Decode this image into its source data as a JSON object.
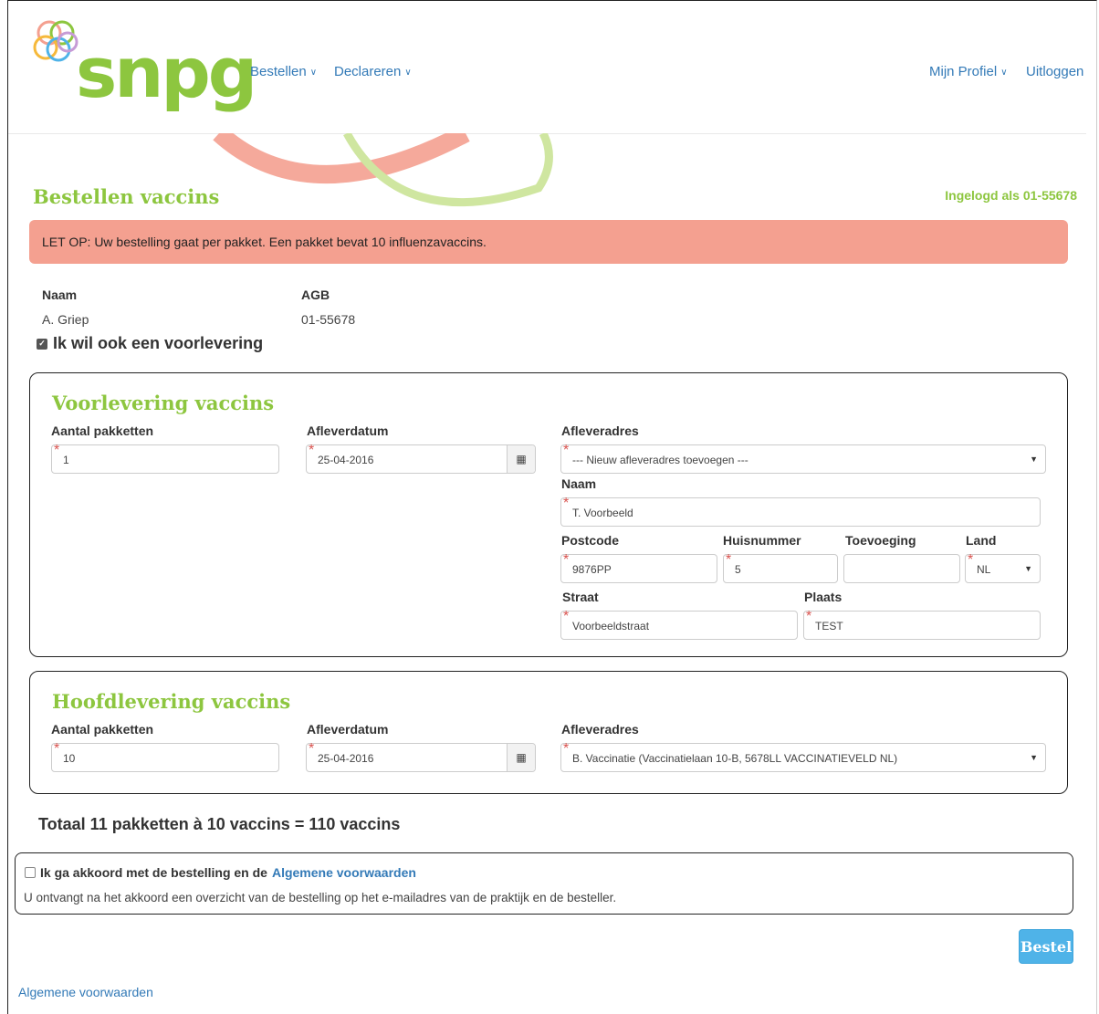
{
  "brand": {
    "logo_text": "snpg",
    "accent": "#8dc63f",
    "link": "#337ab7"
  },
  "nav": {
    "bestellen": "Bestellen",
    "declareren": "Declareren",
    "profiel": "Mijn Profiel",
    "uitloggen": "Uitloggen"
  },
  "page": {
    "title": "Bestellen vaccins",
    "logged_in": "Ingelogd als 01-55678",
    "alert": "LET OP: Uw bestelling gaat per pakket. Een pakket bevat 10 influenzavaccins."
  },
  "info": {
    "naam_label": "Naam",
    "naam_value": "A. Griep",
    "agb_label": "AGB",
    "agb_value": "01-55678",
    "voorlevering_checkbox": "Ik wil ook een voorlevering",
    "voorlevering_checked": true
  },
  "voorlevering": {
    "title": "Voorlevering vaccins",
    "aantal_label": "Aantal pakketten",
    "aantal_value": "1",
    "datum_label": "Afleverdatum",
    "datum_value": "25-04-2016",
    "adres_label": "Afleveradres",
    "adres_value": "--- Nieuw afleveradres toevoegen ---",
    "naam_label": "Naam",
    "naam_value": "T. Voorbeeld",
    "postcode_label": "Postcode",
    "postcode_value": "9876PP",
    "huisnummer_label": "Huisnummer",
    "huisnummer_value": "5",
    "toevoeging_label": "Toevoeging",
    "toevoeging_value": "",
    "land_label": "Land",
    "land_value": "NL",
    "straat_label": "Straat",
    "straat_value": "Voorbeeldstraat",
    "plaats_label": "Plaats",
    "plaats_value": "TEST"
  },
  "hoofdlevering": {
    "title": "Hoofdlevering vaccins",
    "aantal_label": "Aantal pakketten",
    "aantal_value": "10",
    "datum_label": "Afleverdatum",
    "datum_value": "25-04-2016",
    "adres_label": "Afleveradres",
    "adres_value": "B. Vaccinatie (Vaccinatielaan 10-B, 5678LL VACCINATIEVELD NL)"
  },
  "total": "Totaal 11 pakketten à 10 vaccins = 110 vaccins",
  "agree": {
    "text": "Ik ga akkoord met de bestelling en de",
    "link": "Algemene voorwaarden",
    "note": "U ontvangt na het akkoord een overzicht van de bestelling op het e-mailadres van de praktijk en de besteller."
  },
  "bestel_button": "Bestel",
  "footer_link": "Algemene voorwaarden"
}
